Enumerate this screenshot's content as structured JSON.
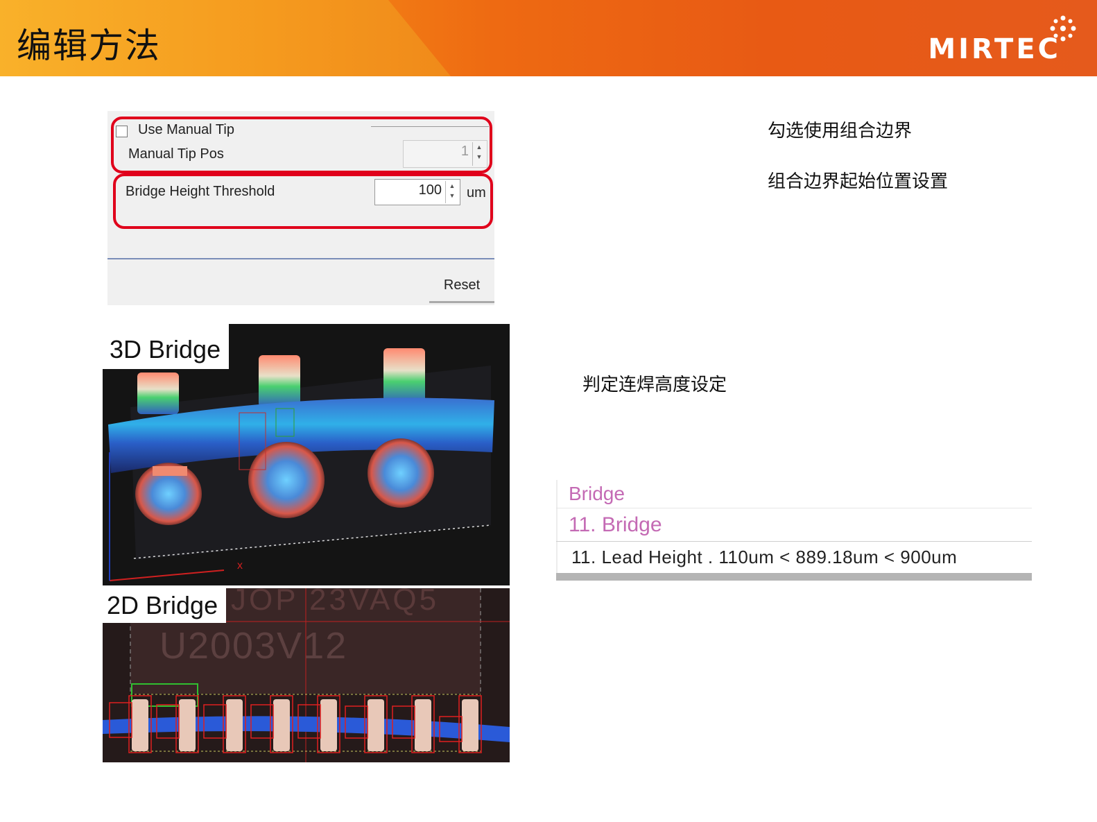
{
  "header": {
    "title": "编辑方法",
    "logo_text": "MIRTEC",
    "colors": {
      "orange": "#e85a14",
      "yellow": "#f7a21b"
    }
  },
  "settings": {
    "use_manual_tip_label": "Use Manual Tip",
    "use_manual_tip_checked": false,
    "manual_tip_pos_label": "Manual Tip Pos",
    "manual_tip_pos_value": "1",
    "bridge_height_threshold_label": "Bridge Height Threshold",
    "bridge_height_threshold_value": "100",
    "bridge_height_unit": "um",
    "reset_label": "Reset"
  },
  "notes": {
    "use_combined_border": "勾选使用组合边界",
    "combined_border_start": "组合边界起始位置设置",
    "bridge_height_setting": "判定连焊高度设定"
  },
  "images": {
    "bridge_3d_label": "3D Bridge",
    "bridge_2d_label": "2D Bridge",
    "axis_x_label": "x",
    "chip_marking_top": "JOP 23VAQ5",
    "chip_marking": "U2003V12"
  },
  "result": {
    "category": "Bridge",
    "item": "11. Bridge",
    "detail": "11. Lead Height . 110um < 889.18um < 900um",
    "colors": {
      "pink": "#c46ab4"
    }
  }
}
